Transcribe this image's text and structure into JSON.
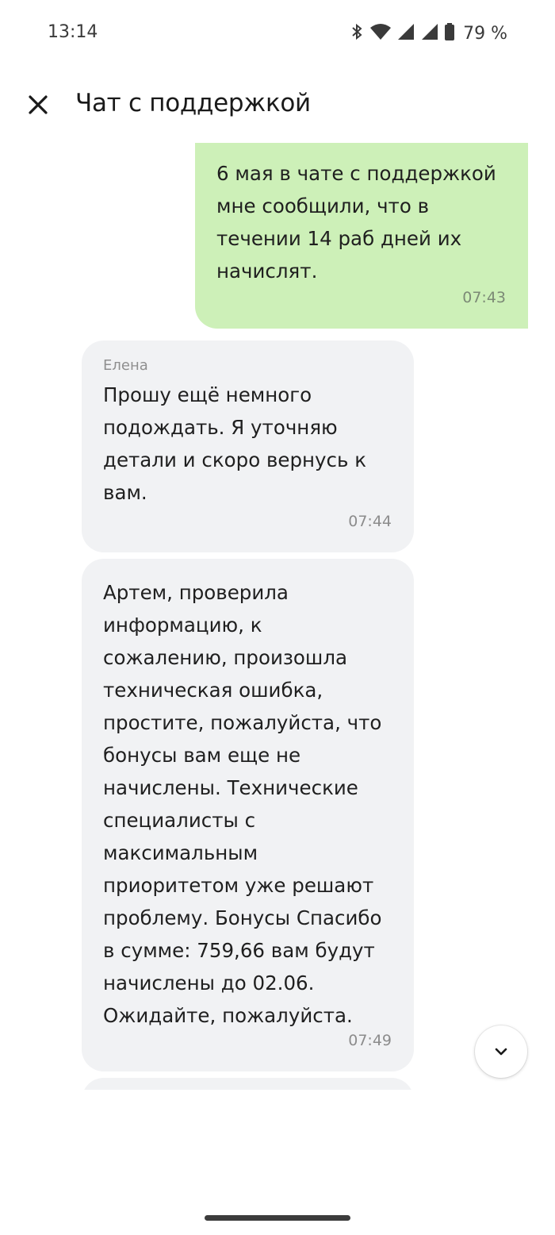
{
  "status_bar": {
    "time": "13:14",
    "battery_percent": "79 %",
    "icons": [
      "bluetooth-icon",
      "wifi-icon",
      "signal-icon",
      "signal-icon",
      "battery-icon"
    ]
  },
  "header": {
    "title": "Чат с поддержкой",
    "close_icon": "close-icon"
  },
  "messages": [
    {
      "direction": "outgoing",
      "text": "6 мая в чате с поддержкой\nмне сообщили, что в\nтечении 14 раб дней их\nначислят.",
      "time": "07:43"
    },
    {
      "direction": "incoming",
      "sender": "Елена",
      "text": "Прошу ещё немного\nподождать. Я уточняю\nдетали и скоро вернусь к\nвам.",
      "time": "07:44"
    },
    {
      "direction": "incoming",
      "text": "Артем, проверила\nинформацию, к\nсожалению, произошла\nтехническая ошибка,\nпростите, пожалуйста, что\nбонусы вам еще не\nначислены. Технические\nспециалисты с\nмаксимальным\nприоритетом уже решают\nпроблему. Бонусы Спасибо\nв сумме: 759,66 вам будут\nначислены до 02.06.\nОжидайте, пожалуйста.",
      "time": "07:49"
    }
  ],
  "colors": {
    "outgoing_bubble": "#cdf0b8",
    "incoming_bubble": "#f1f2f4",
    "background": "#ffffff"
  },
  "scroll_button_icon": "chevron-down-icon"
}
